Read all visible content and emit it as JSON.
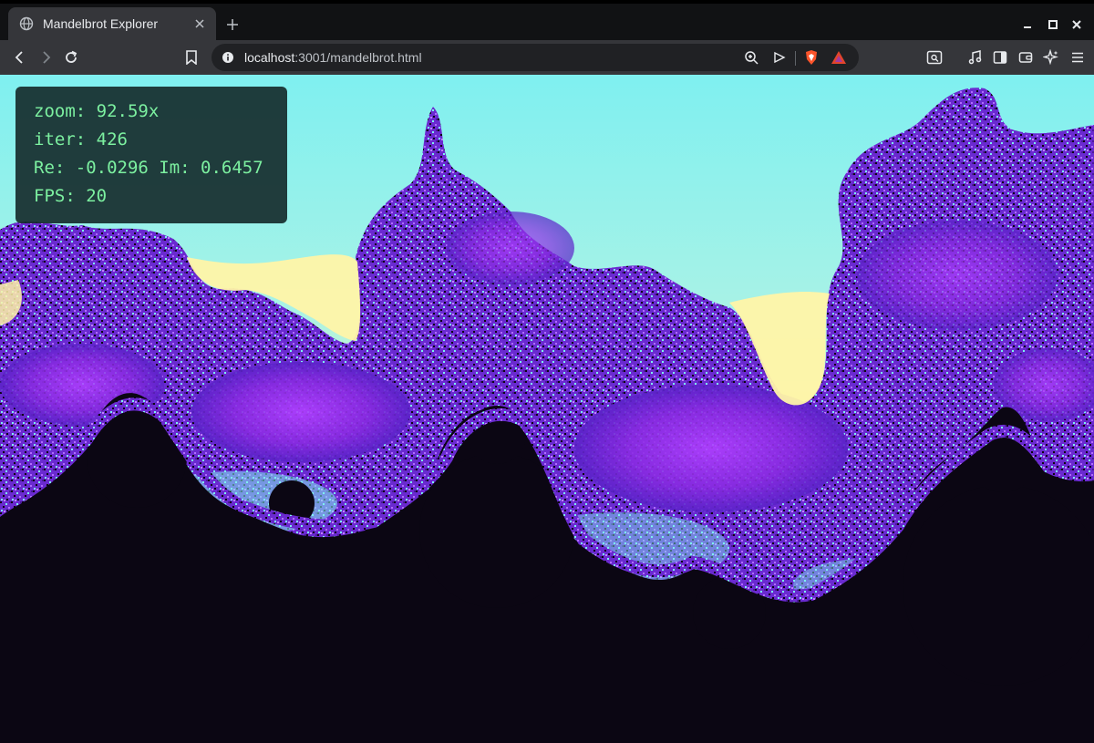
{
  "tab": {
    "title": "Mandelbrot Explorer",
    "favicon": "globe-icon",
    "close_icon": "close-icon"
  },
  "omnibox": {
    "url_host": "localhost",
    "url_rest": ":3001/mandelbrot.html"
  },
  "hud": {
    "zoom": "zoom: 92.59x",
    "iter": "iter: 426",
    "coords": "Re: -0.0296 Im: 0.6457",
    "fps": "FPS: 20"
  },
  "colors": {
    "tabstrip": "#111214",
    "toolbar": "#35363a",
    "omnibox": "#202124",
    "hud_text": "#7cf0a0",
    "fractal_interior": "#0b0613",
    "fractal_yellow": "#fff4a8",
    "fractal_cyan": "#7ff0f0",
    "fractal_purple": "#8a2be2"
  },
  "icons": [
    "back-icon",
    "forward-icon",
    "reload-icon",
    "bookmark-icon",
    "info-icon",
    "zoom-icon",
    "send-icon",
    "brave-shield-icon",
    "brave-rewards-icon",
    "screenshot-icon",
    "media-icon",
    "sidebar-icon",
    "wallet-icon",
    "leo-ai-icon",
    "menu-icon",
    "new-tab-icon",
    "minimize-icon",
    "maximize-icon",
    "window-close-icon"
  ]
}
